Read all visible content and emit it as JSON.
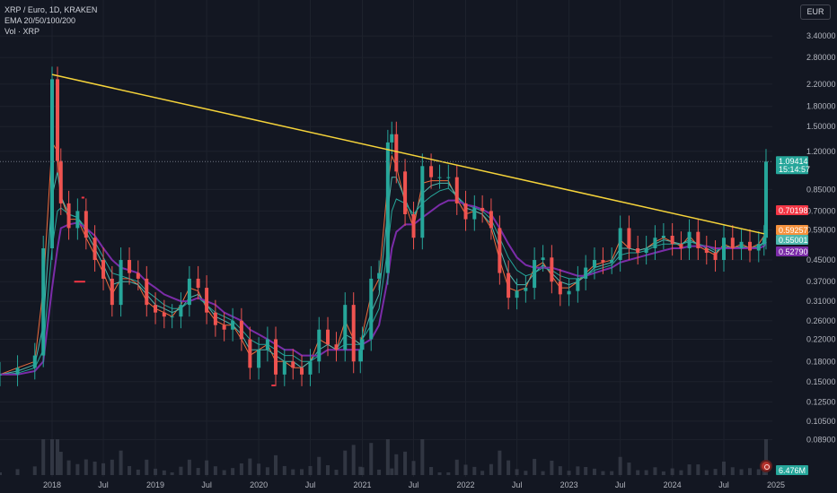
{
  "legend": {
    "symbol_line": "XRP / Euro, 1D, KRAKEN",
    "ema_line": "EMA 20/50/100/200",
    "vol_line": "Vol · XRP"
  },
  "scale_button": "EUR",
  "colors": {
    "background": "#131722",
    "up": "#26a69a",
    "down": "#ef5350",
    "trendline": "#f5d33a",
    "ema20": "#ef6c3c",
    "ema50": "#4db6ac",
    "ema100": "#26a69a",
    "ema200": "#7b2ca8"
  },
  "chart_data": {
    "type": "candlestick",
    "y_scale": "log",
    "ylim": [
      0.07,
      4.0
    ],
    "y_ticks": [
      "3.40000",
      "2.80000",
      "2.20000",
      "1.80000",
      "1.50000",
      "1.20000",
      "0.85000",
      "0.70000",
      "0.59000",
      "0.45000",
      "0.37000",
      "0.31000",
      "0.26000",
      "0.22000",
      "0.18000",
      "0.15000",
      "0.12500",
      "0.10500",
      "0.08900"
    ],
    "x_ticks": [
      "2018",
      "Jul",
      "2019",
      "Jul",
      "2020",
      "Jul",
      "2021",
      "Jul",
      "2022",
      "Jul",
      "2023",
      "Jul",
      "2024",
      "Jul",
      "2025"
    ],
    "price_series": {
      "x": [
        "2017-07",
        "2017-09",
        "2017-11",
        "2017-12",
        "2018-01",
        "2018-01-20",
        "2018-02",
        "2018-03",
        "2018-04",
        "2018-05",
        "2018-06",
        "2018-07",
        "2018-08",
        "2018-09",
        "2018-10",
        "2018-11",
        "2018-12",
        "2019-01",
        "2019-02",
        "2019-03",
        "2019-04",
        "2019-05",
        "2019-06",
        "2019-07",
        "2019-08",
        "2019-09",
        "2019-10",
        "2019-11",
        "2019-12",
        "2020-01",
        "2020-02",
        "2020-03",
        "2020-04",
        "2020-05",
        "2020-06",
        "2020-07",
        "2020-08",
        "2020-09",
        "2020-10",
        "2020-11",
        "2020-12",
        "2020-12-25",
        "2021-01",
        "2021-02",
        "2021-03",
        "2021-04",
        "2021-04-15",
        "2021-05",
        "2021-06",
        "2021-07",
        "2021-08",
        "2021-09",
        "2021-10",
        "2021-11",
        "2021-12",
        "2022-01",
        "2022-02",
        "2022-03",
        "2022-04",
        "2022-05",
        "2022-06",
        "2022-07",
        "2022-08",
        "2022-09",
        "2022-10",
        "2022-11",
        "2022-12",
        "2023-01",
        "2023-02",
        "2023-03",
        "2023-04",
        "2023-05",
        "2023-06",
        "2023-07",
        "2023-08",
        "2023-09",
        "2023-10",
        "2023-11",
        "2023-12",
        "2024-01",
        "2024-02",
        "2024-03",
        "2024-04",
        "2024-05",
        "2024-06",
        "2024-07",
        "2024-08",
        "2024-09",
        "2024-10",
        "2024-11",
        "2024-11-20",
        "2024-11-27"
      ],
      "close": [
        0.16,
        0.17,
        0.19,
        0.5,
        2.3,
        1.1,
        0.75,
        0.6,
        0.7,
        0.55,
        0.45,
        0.38,
        0.3,
        0.45,
        0.4,
        0.38,
        0.3,
        0.28,
        0.27,
        0.27,
        0.3,
        0.38,
        0.35,
        0.28,
        0.25,
        0.24,
        0.26,
        0.22,
        0.17,
        0.2,
        0.22,
        0.16,
        0.18,
        0.17,
        0.16,
        0.18,
        0.24,
        0.21,
        0.2,
        0.3,
        0.18,
        0.2,
        0.22,
        0.38,
        0.4,
        1.3,
        1.4,
        1.0,
        0.68,
        0.55,
        1.05,
        0.95,
        0.95,
        0.95,
        0.75,
        0.65,
        0.72,
        0.7,
        0.6,
        0.4,
        0.32,
        0.34,
        0.35,
        0.45,
        0.46,
        0.37,
        0.33,
        0.34,
        0.38,
        0.42,
        0.45,
        0.44,
        0.45,
        0.6,
        0.5,
        0.48,
        0.5,
        0.55,
        0.56,
        0.52,
        0.5,
        0.58,
        0.5,
        0.48,
        0.45,
        0.55,
        0.5,
        0.53,
        0.49,
        0.52,
        0.55,
        1.09414
      ]
    },
    "trendline": {
      "start": [
        "2018-01",
        2.4
      ],
      "end": [
        "2024-11-20",
        0.57
      ]
    },
    "ema_series": [
      {
        "name": "EMA 20",
        "values": [
          0.16,
          0.17,
          0.18,
          0.35,
          1.3,
          1.2,
          0.8,
          0.65,
          0.65,
          0.55,
          0.47,
          0.4,
          0.33,
          0.38,
          0.38,
          0.36,
          0.31,
          0.29,
          0.28,
          0.27,
          0.3,
          0.35,
          0.34,
          0.29,
          0.26,
          0.25,
          0.25,
          0.22,
          0.19,
          0.2,
          0.21,
          0.18,
          0.18,
          0.17,
          0.17,
          0.18,
          0.22,
          0.21,
          0.2,
          0.26,
          0.22,
          0.21,
          0.23,
          0.33,
          0.38,
          0.9,
          1.15,
          1.05,
          0.75,
          0.6,
          0.9,
          0.92,
          0.92,
          0.92,
          0.78,
          0.68,
          0.7,
          0.68,
          0.6,
          0.45,
          0.35,
          0.34,
          0.35,
          0.42,
          0.44,
          0.39,
          0.35,
          0.35,
          0.37,
          0.4,
          0.43,
          0.44,
          0.45,
          0.54,
          0.5,
          0.49,
          0.5,
          0.53,
          0.55,
          0.53,
          0.51,
          0.56,
          0.51,
          0.49,
          0.47,
          0.52,
          0.5,
          0.52,
          0.5,
          0.52,
          0.56,
          0.8
        ]
      },
      {
        "name": "EMA 50",
        "values": [
          0.16,
          0.165,
          0.175,
          0.25,
          0.8,
          1.0,
          0.8,
          0.68,
          0.66,
          0.58,
          0.5,
          0.43,
          0.36,
          0.37,
          0.37,
          0.36,
          0.33,
          0.3,
          0.29,
          0.28,
          0.29,
          0.32,
          0.33,
          0.3,
          0.27,
          0.26,
          0.25,
          0.23,
          0.2,
          0.2,
          0.2,
          0.19,
          0.18,
          0.18,
          0.17,
          0.18,
          0.2,
          0.21,
          0.2,
          0.23,
          0.22,
          0.21,
          0.22,
          0.28,
          0.33,
          0.7,
          0.95,
          0.95,
          0.78,
          0.65,
          0.82,
          0.88,
          0.9,
          0.9,
          0.8,
          0.72,
          0.7,
          0.68,
          0.62,
          0.5,
          0.4,
          0.36,
          0.36,
          0.4,
          0.43,
          0.4,
          0.37,
          0.36,
          0.37,
          0.39,
          0.42,
          0.43,
          0.44,
          0.5,
          0.5,
          0.49,
          0.5,
          0.52,
          0.54,
          0.53,
          0.52,
          0.54,
          0.52,
          0.5,
          0.48,
          0.51,
          0.5,
          0.51,
          0.5,
          0.51,
          0.53,
          0.65
        ]
      },
      {
        "name": "EMA 100",
        "values": [
          0.16,
          0.162,
          0.17,
          0.2,
          0.5,
          0.7,
          0.72,
          0.68,
          0.66,
          0.6,
          0.53,
          0.46,
          0.4,
          0.39,
          0.38,
          0.37,
          0.34,
          0.32,
          0.3,
          0.29,
          0.29,
          0.31,
          0.32,
          0.3,
          0.28,
          0.27,
          0.26,
          0.24,
          0.22,
          0.21,
          0.21,
          0.2,
          0.19,
          0.19,
          0.18,
          0.18,
          0.19,
          0.2,
          0.2,
          0.21,
          0.21,
          0.21,
          0.22,
          0.25,
          0.29,
          0.5,
          0.7,
          0.78,
          0.75,
          0.68,
          0.75,
          0.8,
          0.84,
          0.86,
          0.8,
          0.74,
          0.72,
          0.7,
          0.65,
          0.55,
          0.46,
          0.41,
          0.39,
          0.4,
          0.42,
          0.41,
          0.39,
          0.38,
          0.38,
          0.39,
          0.41,
          0.42,
          0.43,
          0.47,
          0.48,
          0.48,
          0.49,
          0.51,
          0.52,
          0.52,
          0.52,
          0.53,
          0.52,
          0.51,
          0.49,
          0.5,
          0.5,
          0.5,
          0.5,
          0.51,
          0.52,
          0.58
        ]
      },
      {
        "name": "EMA 200",
        "values": [
          0.16,
          0.16,
          0.165,
          0.18,
          0.35,
          0.5,
          0.6,
          0.62,
          0.63,
          0.6,
          0.56,
          0.5,
          0.45,
          0.42,
          0.41,
          0.4,
          0.37,
          0.35,
          0.33,
          0.32,
          0.31,
          0.31,
          0.32,
          0.31,
          0.3,
          0.28,
          0.27,
          0.26,
          0.24,
          0.23,
          0.22,
          0.21,
          0.2,
          0.2,
          0.19,
          0.19,
          0.19,
          0.2,
          0.2,
          0.2,
          0.2,
          0.2,
          0.21,
          0.22,
          0.25,
          0.38,
          0.5,
          0.58,
          0.62,
          0.62,
          0.66,
          0.7,
          0.74,
          0.77,
          0.77,
          0.74,
          0.73,
          0.71,
          0.68,
          0.6,
          0.52,
          0.46,
          0.43,
          0.42,
          0.42,
          0.42,
          0.41,
          0.4,
          0.39,
          0.39,
          0.4,
          0.41,
          0.42,
          0.44,
          0.45,
          0.46,
          0.47,
          0.48,
          0.49,
          0.5,
          0.5,
          0.51,
          0.51,
          0.51,
          0.5,
          0.5,
          0.5,
          0.5,
          0.5,
          0.5,
          0.51,
          0.53
        ]
      }
    ],
    "price_labels": [
      {
        "value": 1.09414,
        "text": "1.09414",
        "subtext": "15:14:57",
        "color": "#26a69a"
      },
      {
        "value": 0.70198,
        "text": "0.70198",
        "color": "#f23645"
      },
      {
        "value": 0.59257,
        "text": "0.59257",
        "color": "#f5913c"
      },
      {
        "value": 0.55,
        "text": "0.55001",
        "color": "#4db6ac"
      },
      {
        "value": 0.5279,
        "text": "0.52790",
        "color": "#7b2ca8"
      }
    ],
    "volume_label": "6.476M",
    "horizontal_marks": [
      {
        "from": "2018-03-20",
        "to": "2018-04-28",
        "price": 0.37
      },
      {
        "from": "2020-02-15",
        "to": "2020-02-28",
        "price": 0.145
      },
      {
        "from": "2018-04-15",
        "to": "2018-04-25",
        "price": 0.79
      }
    ]
  }
}
